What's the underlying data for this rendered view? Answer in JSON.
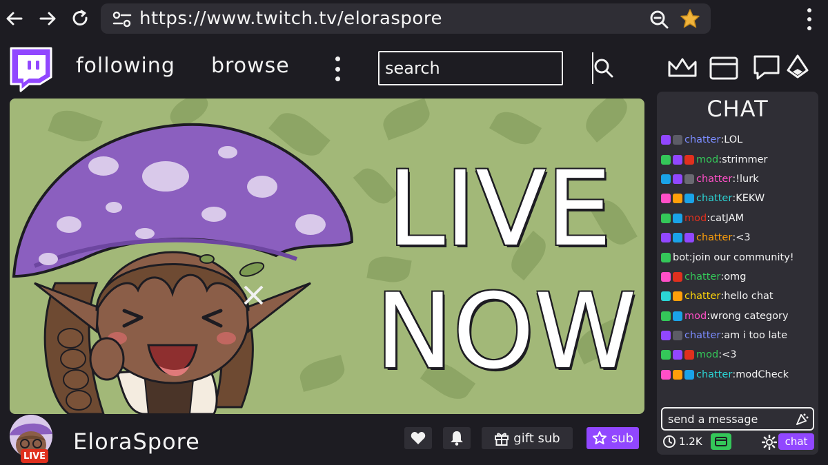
{
  "browser": {
    "url": "https://www.twitch.tv/eloraspore"
  },
  "nav": {
    "following": "following",
    "browse": "browse"
  },
  "search": {
    "placeholder": "search"
  },
  "stream": {
    "overlay_line1": "LIVE",
    "overlay_line2": "NOW",
    "streamer_name": "EloraSpore",
    "live_badge": "LIVE"
  },
  "actions": {
    "gift_sub": "gift sub",
    "sub": "sub"
  },
  "chat": {
    "title": "CHAT",
    "messages": [
      {
        "badges": [
          "#9147ff",
          "#5c5c66"
        ],
        "user": "chatter",
        "user_color": "#7b8cff",
        "text": "LOL"
      },
      {
        "badges": [
          "#34c759",
          "#9147ff",
          "#e0301e"
        ],
        "user": "mod",
        "user_color": "#34c759",
        "text": "strimmer"
      },
      {
        "badges": [
          "#1aa3e8",
          "#9147ff",
          "#6a6a72"
        ],
        "user": "chatter",
        "user_color": "#ff4fc7",
        "text": "!lurk"
      },
      {
        "badges": [
          "#ff4fc7",
          "#ff9f0a",
          "#1aa3e8"
        ],
        "user": "chatter",
        "user_color": "#2bd5d5",
        "text": "KEKW"
      },
      {
        "badges": [
          "#34c759",
          "#1aa3e8"
        ],
        "user": "mod",
        "user_color": "#e0301e",
        "text": "catJAM"
      },
      {
        "badges": [
          "#9147ff",
          "#1aa3e8",
          "#9147ff"
        ],
        "user": "chatter",
        "user_color": "#ff9f0a",
        "text": "<3"
      },
      {
        "badges": [
          "#34c759"
        ],
        "user": "bot",
        "user_color": "#f3f3f3",
        "text": "join our community!"
      },
      {
        "badges": [
          "#ff4fc7",
          "#e0301e"
        ],
        "user": "chatter",
        "user_color": "#34c759",
        "text": "omg"
      },
      {
        "badges": [
          "#2bd5d5",
          "#ff9f0a"
        ],
        "user": "chatter",
        "user_color": "#ffd60a",
        "text": "hello chat"
      },
      {
        "badges": [
          "#34c759",
          "#1aa3e8"
        ],
        "user": "mod",
        "user_color": "#ff4fc7",
        "text": "wrong category"
      },
      {
        "badges": [
          "#9147ff",
          "#5c5c66"
        ],
        "user": "chatter",
        "user_color": "#7b8cff",
        "text": "am i too late"
      },
      {
        "badges": [
          "#34c759",
          "#9147ff",
          "#e0301e"
        ],
        "user": "mod",
        "user_color": "#34c759",
        "text": "<3"
      },
      {
        "badges": [
          "#ff4fc7",
          "#ff9f0a",
          "#1aa3e8"
        ],
        "user": "chatter",
        "user_color": "#2bd5d5",
        "text": "modCheck"
      }
    ],
    "send_placeholder": "send a message",
    "viewer_count": "1.2K",
    "chat_button": "chat"
  },
  "colors": {
    "accent": "#9147ff",
    "live_red": "#e0301e",
    "bg": "#1d1c22",
    "panel": "#2f2e35",
    "player_green": "#a2b878"
  }
}
